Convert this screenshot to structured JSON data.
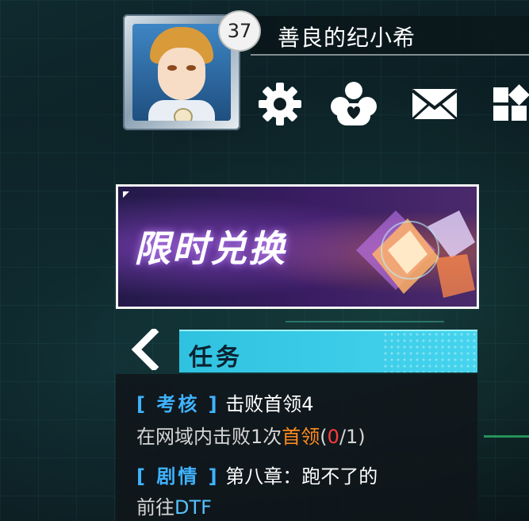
{
  "player": {
    "level": "37",
    "name": "善良的纪小希"
  },
  "toolbar": {
    "icons": [
      "gear-icon",
      "friends-icon",
      "mail-icon",
      "menu-grid-icon"
    ]
  },
  "banner": {
    "title": "限时兑换"
  },
  "quest": {
    "tab_label": "任务",
    "tasks": [
      {
        "tag": "[ 考核 ]",
        "title": "击败首领4",
        "desc_prefix": "在网域内击败1次",
        "desc_highlight": "首领",
        "progress_open": "(",
        "progress_current": "0",
        "progress_total": "/1)"
      },
      {
        "tag": "[ 剧情 ]",
        "title": "第八章：跑不了的",
        "desc_prefix": "前往",
        "desc_highlight": "DTF"
      }
    ]
  },
  "colors": {
    "tag_blue": "#3fb3ff",
    "highlight_orange": "#ff8a1f",
    "progress_red": "#ff3b3b",
    "tab_cyan": "#2fc2e0"
  }
}
